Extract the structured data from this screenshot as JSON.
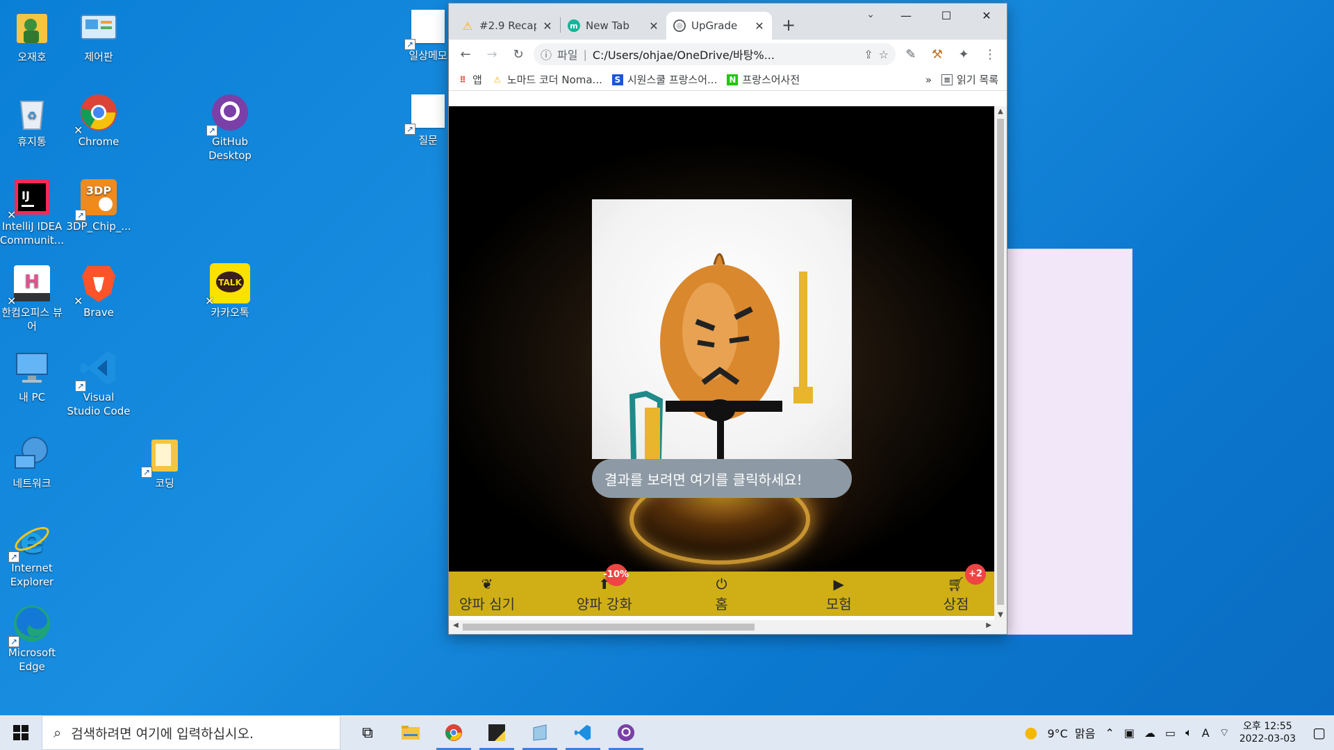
{
  "desktop": {
    "icons": [
      {
        "label": "오재호"
      },
      {
        "label": "제어판"
      },
      {
        "label": "휴지통"
      },
      {
        "label": "Chrome"
      },
      {
        "label": "GitHub Desktop"
      },
      {
        "label": "IntelliJ IDEA Communit..."
      },
      {
        "label": "3DP_Chip_..."
      },
      {
        "label": "한컴오피스 뷰어"
      },
      {
        "label": "Brave"
      },
      {
        "label": "카카오톡"
      },
      {
        "label": "내 PC"
      },
      {
        "label": "Visual Studio Code"
      },
      {
        "label": "네트워크"
      },
      {
        "label": "코딩"
      },
      {
        "label": "Internet Explorer"
      },
      {
        "label": "Microsoft Edge"
      },
      {
        "label": "일상메모"
      },
      {
        "label": "질문"
      }
    ]
  },
  "browser": {
    "tabs": [
      {
        "title": "#2.9 Recap",
        "icon": "nomad-icon"
      },
      {
        "title": "New Tab",
        "icon": "m-icon"
      },
      {
        "title": "UpGrade",
        "icon": "globe-icon"
      }
    ],
    "address": {
      "scheme": "파일",
      "url": "C:/Users/ohjae/OneDrive/바탕%..."
    },
    "bookmarks": [
      {
        "label": "앱"
      },
      {
        "label": "노마드 코더 Noma..."
      },
      {
        "label": "시원스쿨 프랑스어..."
      },
      {
        "label": "프랑스어사전"
      }
    ],
    "bookmarks_more": "»",
    "reading_list": "읽기 목록"
  },
  "page": {
    "result_button": "결과를 보려면 여기를 클릭하세요!",
    "nav": [
      {
        "label": "양파 심기",
        "icon": "sprout-icon",
        "badge": ""
      },
      {
        "label": "양파 강화",
        "icon": "upgrade-icon",
        "badge": "-10%"
      },
      {
        "label": "홈",
        "icon": "power-icon",
        "badge": ""
      },
      {
        "label": "모험",
        "icon": "play-icon",
        "badge": ""
      },
      {
        "label": "상점",
        "icon": "cart-icon",
        "badge": "+2"
      }
    ],
    "nav_color": "#cfaf15"
  },
  "taskbar": {
    "search_placeholder": "검색하려면 여기에 입력하십시오.",
    "weather": "9°C  맑음",
    "time": "오후 12:55",
    "date": "2022-03-03"
  }
}
